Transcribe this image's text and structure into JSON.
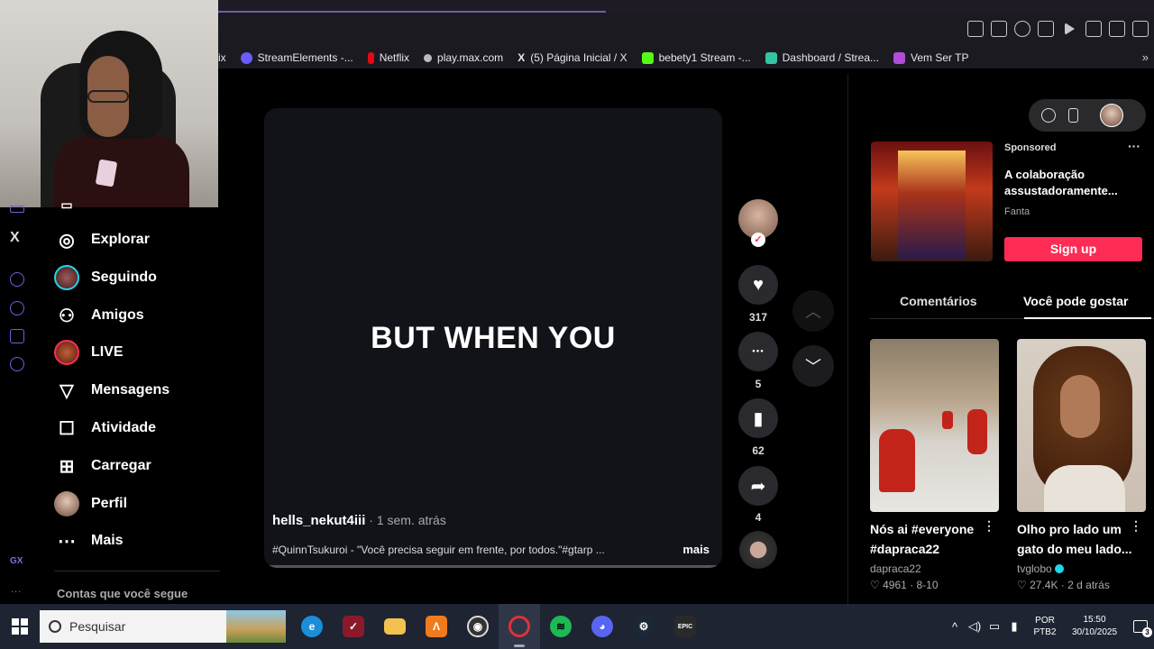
{
  "browser": {
    "bookmarks": [
      {
        "label": "StreamElements -...",
        "color": "#6a5cff"
      },
      {
        "label": "Netflix",
        "color": "#e50914"
      },
      {
        "label": "play.max.com",
        "color": "#bbbbbb"
      },
      {
        "label": "(5) Página Inicial / X",
        "color": "#dddddd"
      },
      {
        "label": "bebety1 Stream -...",
        "color": "#53fc18"
      },
      {
        "label": "Dashboard / Strea...",
        "color": "#33c4a3"
      },
      {
        "label": "Vem Ser TP",
        "color": "#b14cd6"
      }
    ],
    "bookmark_prefix": "ix",
    "more_glyph": "»"
  },
  "rail": {
    "x_logo": "X",
    "gx_label": "GX",
    "dots": "..."
  },
  "nav": {
    "items": [
      {
        "label": "Explorar",
        "icon": "compass-icon",
        "glyph": "◎"
      },
      {
        "label": "Seguindo",
        "icon": "following-avatar",
        "glyph": ""
      },
      {
        "label": "Amigos",
        "icon": "friends-icon",
        "glyph": "⚇"
      },
      {
        "label": "LIVE",
        "icon": "live-avatar",
        "glyph": ""
      },
      {
        "label": "Mensagens",
        "icon": "messages-icon",
        "glyph": "▽"
      },
      {
        "label": "Atividade",
        "icon": "activity-icon",
        "glyph": "☐"
      },
      {
        "label": "Carregar",
        "icon": "upload-icon",
        "glyph": "⊞"
      },
      {
        "label": "Perfil",
        "icon": "profile-avatar",
        "glyph": ""
      },
      {
        "label": "Mais",
        "icon": "more-icon",
        "glyph": "⋯"
      }
    ],
    "following_title": "Contas que você segue"
  },
  "video": {
    "caption": "BUT WHEN YOU",
    "author": "hells_nekut4iii",
    "time": " · 1 sem. atrás",
    "description": "#QuinnTsukuroi - \"Você precisa seguir em frente, por todos.\"#gtarp ...",
    "more": "mais"
  },
  "actions": {
    "likes": "317",
    "comments": "5",
    "saves": "62",
    "shares": "4",
    "follow_check": "✓",
    "like_glyph": "♥",
    "comment_glyph": "●●●",
    "save_glyph": "▮",
    "share_glyph": "➦",
    "up_glyph": "︿",
    "down_glyph": "﹀"
  },
  "ad": {
    "sponsored": "Sponsored",
    "dots": "···",
    "title": "A colaboração assustadoramente...",
    "brand": "Fanta",
    "cta": "Sign up"
  },
  "panel_tabs": {
    "comments": "Comentários",
    "you_may_like": "Você pode gostar"
  },
  "recommendations": [
    {
      "title": "Nós ai #everyone #dapraca22",
      "author": "dapraca22",
      "likes": "4961",
      "date": "8-10",
      "verified": false
    },
    {
      "title": "Olho pro lado um gato do meu lado...",
      "author": "tvglobo",
      "likes": "27.4K",
      "date": "2 d atrás",
      "verified": true
    }
  ],
  "taskbar": {
    "search_placeholder": "Pesquisar",
    "apps": [
      {
        "name": "edge-icon",
        "color": "#1a8fd8",
        "glyph": "e"
      },
      {
        "name": "app-red-icon",
        "color": "#8a1a2a",
        "glyph": "✓"
      },
      {
        "name": "folder-icon",
        "color": "#f2c14e",
        "glyph": ""
      },
      {
        "name": "app-orange-icon",
        "color": "#f07b1e",
        "glyph": "Λ"
      },
      {
        "name": "obs-icon",
        "color": "#333333",
        "glyph": "◉"
      },
      {
        "name": "opera-icon",
        "color": "#e0303a",
        "glyph": "O"
      },
      {
        "name": "spotify-icon",
        "color": "#1db954",
        "glyph": "≋"
      },
      {
        "name": "discord-icon",
        "color": "#5865f2",
        "glyph": "◕"
      },
      {
        "name": "steam-icon",
        "color": "#1b2838",
        "glyph": "⚙"
      },
      {
        "name": "epic-icon",
        "color": "#2a2a2a",
        "glyph": "EPIC"
      }
    ],
    "lang_line1": "POR",
    "lang_line2": "PTB2",
    "time": "15:50",
    "date": "30/10/2025",
    "notifications": "3"
  }
}
